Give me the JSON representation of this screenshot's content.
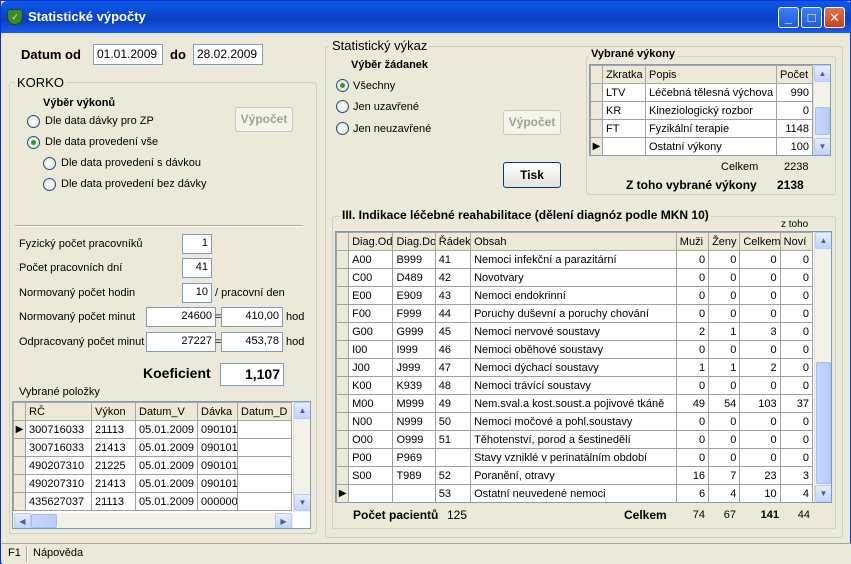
{
  "window": {
    "title": "Statistické výpočty",
    "icon": "app-shield-icon"
  },
  "date": {
    "from_label": "Datum od",
    "from": "01.01.2009",
    "to_label": "do",
    "to": "28.02.2009"
  },
  "korko": {
    "title": "KORKO",
    "selection_label": "Výběr výkonů",
    "options": [
      "Dle data dávky pro ZP",
      "Dle data provedení vše",
      "Dle data provedení s dávkou",
      "Dle data provedení bez dávky"
    ],
    "selected": 1,
    "calc_button": "Výpočet",
    "staff_label": "Fyzický počet pracovníků",
    "staff": "1",
    "days_label": "Počet pracovních dní",
    "days": "41",
    "hours_label": "Normovaný počet hodin",
    "hours": "10",
    "hours_unit": "/ pracovní den",
    "norm_min_label": "Normovaný počet minut",
    "norm_min": "24600",
    "eq": "=",
    "norm_hours": "410,00",
    "hod": "hod",
    "work_min_label": "Odpracovaný počet minut",
    "work_min": "27227",
    "work_hours": "453,78",
    "coef_label": "Koeficient",
    "coef": "1,107",
    "items_label": "Vybrané položky",
    "items_columns": [
      "RČ",
      "Výkon",
      "Datum_V",
      "Dávka",
      "Datum_D"
    ],
    "items_rows": [
      [
        "300716033",
        "21113",
        "05.01.2009",
        "090101",
        ""
      ],
      [
        "300716033",
        "21413",
        "05.01.2009",
        "090101",
        ""
      ],
      [
        "490207310",
        "21225",
        "05.01.2009",
        "090101",
        ""
      ],
      [
        "490207310",
        "21413",
        "05.01.2009",
        "090101",
        ""
      ],
      [
        "435627037",
        "21113",
        "05.01.2009",
        "000000",
        ""
      ]
    ]
  },
  "vykaz": {
    "title": "Statistický výkaz",
    "requests_label": "Výběr žádanek",
    "options": [
      "Všechny",
      "Jen uzavřené",
      "Jen neuzavřené"
    ],
    "selected": 0,
    "calc_button": "Výpočet",
    "print_button": "Tisk"
  },
  "vybrane": {
    "title": "Vybrané výkony",
    "columns": [
      "Zkratka",
      "Popis",
      "Počet"
    ],
    "rows": [
      [
        "LTV",
        "Léčebná tělesná výchova",
        "990"
      ],
      [
        "KR",
        "Kineziologický rozbor",
        "0"
      ],
      [
        "FT",
        "Fyzikální terapie",
        "1148"
      ],
      [
        "",
        "Ostatní výkony",
        "100"
      ]
    ],
    "total_label": "Celkem",
    "total": "2238",
    "selected_label": "Z toho vybrané výkony",
    "selected_total": "2138"
  },
  "indikace": {
    "title": "III. Indikace léčebné reahabilitace (dělení diagnóz podle MKN 10)",
    "ztoho": "z toho",
    "columns": [
      "Diag.Od",
      "Diag.Do",
      "Řádek",
      "Obsah",
      "Muži",
      "Ženy",
      "Celkem",
      "Noví"
    ],
    "rows": [
      [
        "A00",
        "B999",
        "41",
        "Nemoci infekční a parazitární",
        "0",
        "0",
        "0",
        "0"
      ],
      [
        "C00",
        "D489",
        "42",
        "Novotvary",
        "0",
        "0",
        "0",
        "0"
      ],
      [
        "E00",
        "E909",
        "43",
        "Nemoci endokrinní",
        "0",
        "0",
        "0",
        "0"
      ],
      [
        "F00",
        "F999",
        "44",
        "Poruchy duševní a poruchy chování",
        "0",
        "0",
        "0",
        "0"
      ],
      [
        "G00",
        "G999",
        "45",
        "Nemoci nervové soustavy",
        "2",
        "1",
        "3",
        "0"
      ],
      [
        "I00",
        "I999",
        "46",
        "Nemoci oběhové soustavy",
        "0",
        "0",
        "0",
        "0"
      ],
      [
        "J00",
        "J999",
        "47",
        "Nemoci dýchací soustavy",
        "1",
        "1",
        "2",
        "0"
      ],
      [
        "K00",
        "K939",
        "48",
        "Nemoci trávící soustavy",
        "0",
        "0",
        "0",
        "0"
      ],
      [
        "M00",
        "M999",
        "49",
        "Nem.sval.a kost.soust.a pojivové tkáně",
        "49",
        "54",
        "103",
        "37"
      ],
      [
        "N00",
        "N999",
        "50",
        "Nemoci močové a pohl.soustavy",
        "0",
        "0",
        "0",
        "0"
      ],
      [
        "O00",
        "O999",
        "51",
        "Těhotenství, porod a šestinedělí",
        "0",
        "0",
        "0",
        "0"
      ],
      [
        "P00",
        "P969",
        "",
        "Stavy vzniklé v perinatálním období",
        "0",
        "0",
        "0",
        "0"
      ],
      [
        "S00",
        "T989",
        "52",
        "Poranění, otravy",
        "16",
        "7",
        "23",
        "3"
      ],
      [
        "",
        "",
        "53",
        "Ostatní neuvedené nemoci",
        "6",
        "4",
        "10",
        "4"
      ]
    ],
    "patients_label": "Počet pacientů",
    "patients": "125",
    "total_label": "Celkem",
    "men": "74",
    "women": "67",
    "total": "141",
    "new": "44"
  },
  "statusbar": {
    "key": "F1",
    "help": "Nápověda"
  }
}
